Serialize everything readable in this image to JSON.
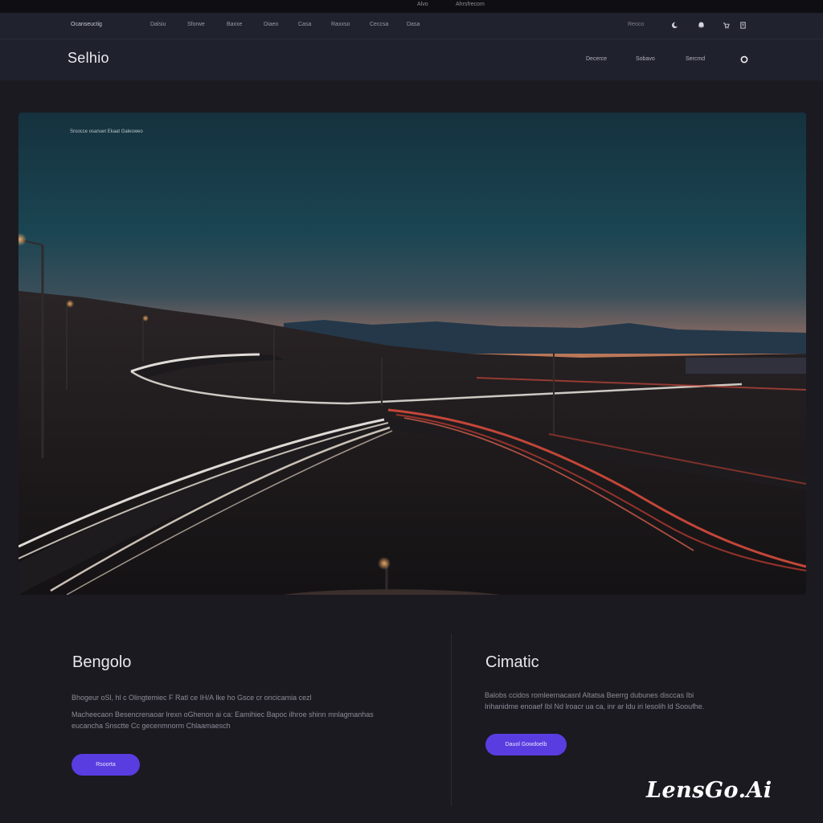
{
  "system_bar": {
    "left_text": "Alvo",
    "right_text": "Ahrsfrecom"
  },
  "top_nav": {
    "brand": "Ocanseuctig",
    "links": [
      "Dalsiu",
      "Sforwe",
      "Baxxe",
      "Diaeo",
      "Casa",
      "Raxxso",
      "Ceccsa",
      "Dasa"
    ],
    "utility_text": "Reoco",
    "icons": [
      "moon-icon",
      "bell-icon",
      "cart-icon",
      "menu-icon"
    ]
  },
  "header": {
    "logo": "Selhio",
    "nav": [
      "Decerce",
      "Sobavo",
      "Sercmd"
    ],
    "icon": "search-icon"
  },
  "hero": {
    "caption": "Sroocce osanuet Ekaat Galeoweo"
  },
  "left_column": {
    "title": "Bengolo",
    "text_lines": [
      "Bhogeur oSl, hl c Olingtemiec F Ratl ce IH/A Ike ho Gsce cr oncicamia cezl",
      "Macheecaon Besencrenaoar lrexn oGhenon ai ca: Eamihiec Bapoc ilhroe shinn mnlagmanhas",
      "eucancha Snsctte Cc gecenmnorm Chlaamaesch"
    ],
    "button_label": "Rsoorta"
  },
  "right_column": {
    "title": "Cimatic",
    "text_lines": [
      "Balobs ccidos romleernacasnl Altatsa Beerrg dubunes disccas Ibi",
      "Irihanidme enoaef Ibl Nd lroacr ua ca, inr ar ldu iri lesolih ld Sooufhe."
    ],
    "button_label": "Dauol Gowdoelb"
  },
  "watermark": "LensGo.Ai"
}
